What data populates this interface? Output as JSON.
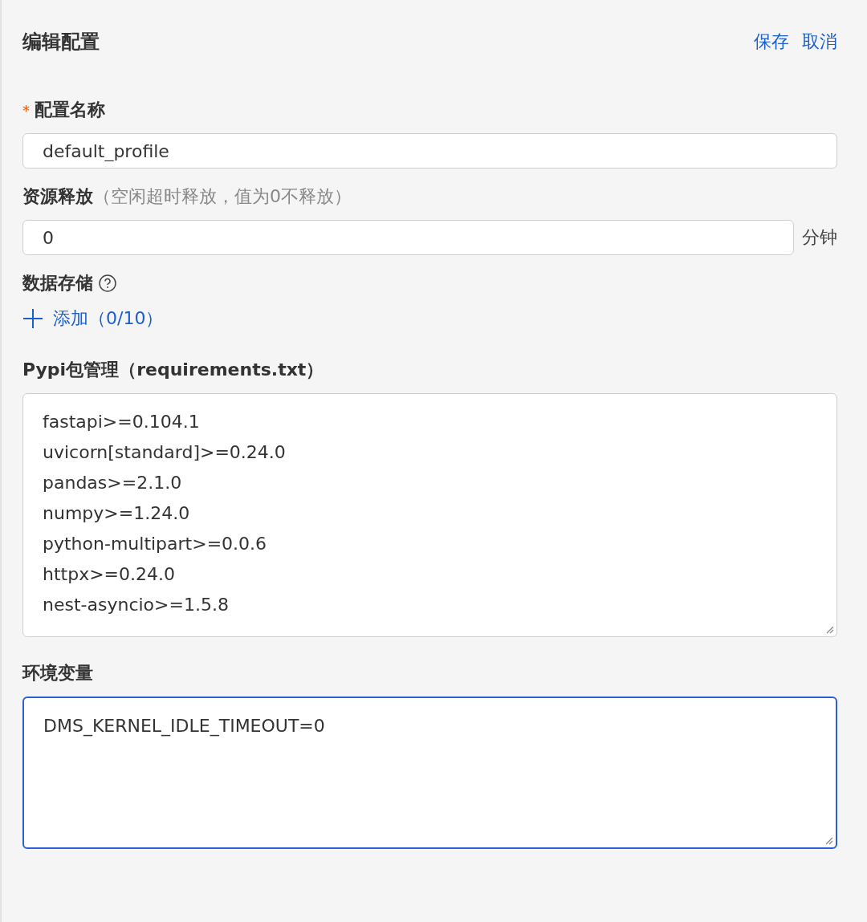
{
  "header": {
    "title": "编辑配置",
    "actions": [
      {
        "label": "保存"
      },
      {
        "label": "取消"
      }
    ]
  },
  "fields": [
    {
      "kind": "input",
      "label": "配置名称",
      "required_mark": "*",
      "value": "default_profile"
    },
    {
      "kind": "input",
      "label": "资源释放",
      "hint": "（空闲超时释放，值为0不释放）",
      "value": "0",
      "suffix": "分钟"
    },
    {
      "kind": "list",
      "label": "数据存储",
      "help": true,
      "add_label": "添加（0/10）"
    },
    {
      "kind": "textarea",
      "label": "Pypi包管理（requirements.txt）",
      "focused": false,
      "lines": [
        "fastapi>=0.104.1",
        "uvicorn[standard]>=0.24.0",
        "pandas>=2.1.0",
        "numpy>=1.24.0",
        "python-multipart>=0.0.6",
        "httpx>=0.24.0",
        "nest-asyncio>=1.5.8"
      ]
    },
    {
      "kind": "textarea",
      "label": "环境变量",
      "focused": true,
      "lines": [
        "DMS_KERNEL_IDLE_TIMEOUT=0"
      ]
    }
  ]
}
